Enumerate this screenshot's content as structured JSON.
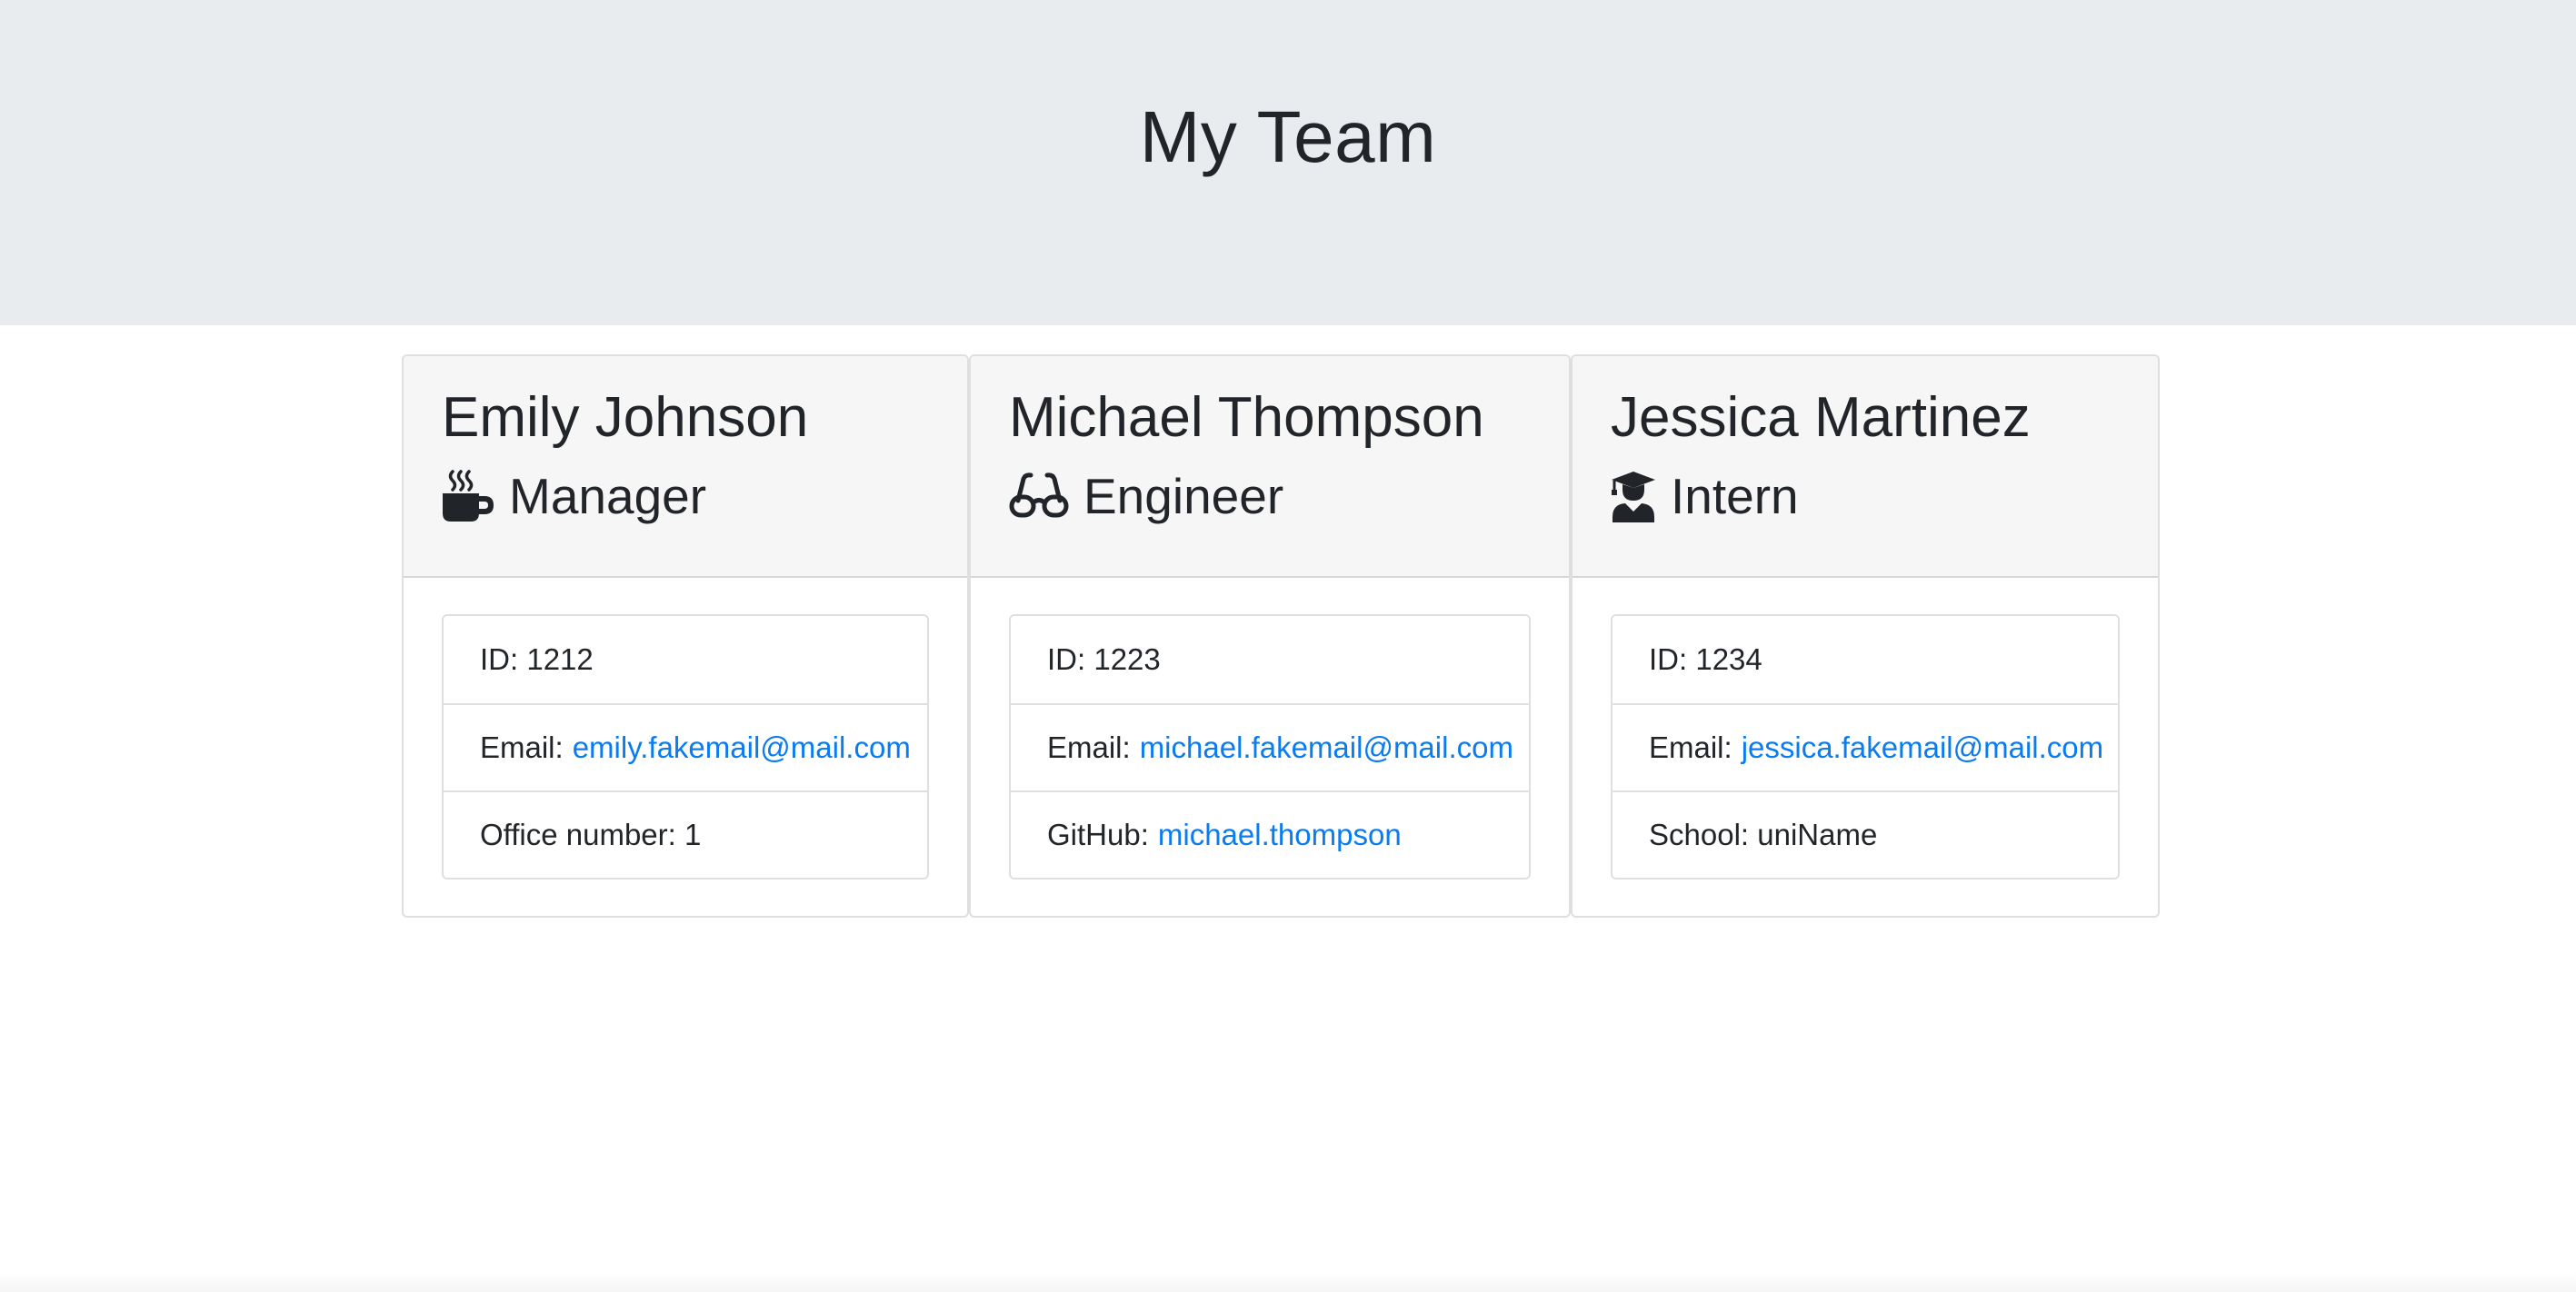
{
  "header": {
    "title": "My Team"
  },
  "team": [
    {
      "name": "Emily Johnson",
      "role": "Manager",
      "role_icon": "mug-hot-icon",
      "id_text": "ID: 1212",
      "email_label": "Email:",
      "email": "emily.fakemail@mail.com",
      "extra_label": "Office number: 1",
      "extra_link": ""
    },
    {
      "name": "Michael Thompson",
      "role": "Engineer",
      "role_icon": "glasses-icon",
      "id_text": "ID: 1223",
      "email_label": "Email:",
      "email": "michael.fakemail@mail.com",
      "extra_label": "GitHub:",
      "extra_link": "michael.thompson"
    },
    {
      "name": "Jessica Martinez",
      "role": "Intern",
      "role_icon": "user-graduate-icon",
      "id_text": "ID: 1234",
      "email_label": "Email:",
      "email": "jessica.fakemail@mail.com",
      "extra_label": "School: uniName",
      "extra_link": ""
    }
  ],
  "colors": {
    "header_bg": "#e9ecef",
    "card_header_bg": "#f6f6f6",
    "link": "#0b7bf0",
    "text": "#212529"
  }
}
